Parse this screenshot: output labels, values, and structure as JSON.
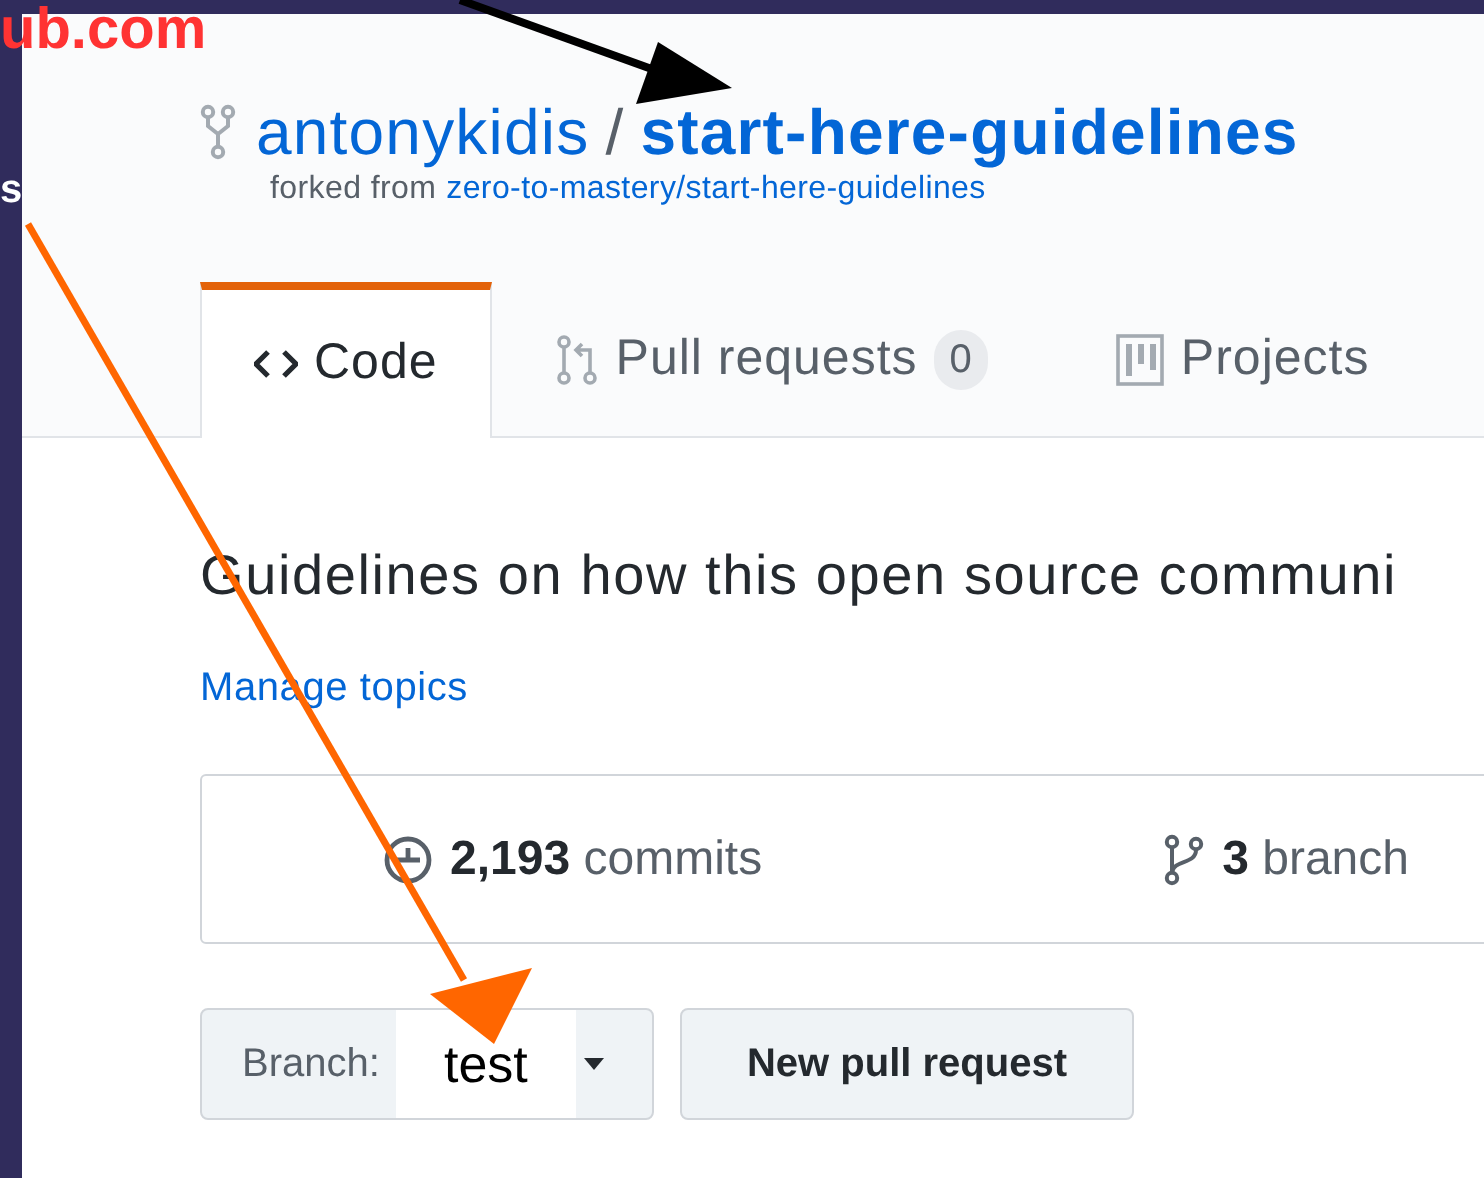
{
  "annotations": {
    "site_fragment": "ub.com",
    "side_fragment": "s",
    "branch_overlay": "test"
  },
  "repo": {
    "owner": "antonykidis",
    "separator": "/",
    "name": "start-here-guidelines",
    "forked_prefix": "forked from",
    "forked_source": "zero-to-mastery/start-here-guidelines"
  },
  "tabs": [
    {
      "label": "Code",
      "selected": true,
      "kind": "code"
    },
    {
      "label": "Pull requests",
      "count": "0",
      "selected": false,
      "kind": "pull"
    },
    {
      "label": "Projects",
      "selected": false,
      "kind": "projects"
    }
  ],
  "description": "Guidelines on how this open source communi",
  "manage_topics": "Manage topics",
  "stats": [
    {
      "kind": "commits",
      "count": "2,193",
      "label": "commits"
    },
    {
      "kind": "branches",
      "count": "3",
      "label": "branch"
    }
  ],
  "branch_button": {
    "label": "Branch:"
  },
  "new_pull_request": "New pull request"
}
